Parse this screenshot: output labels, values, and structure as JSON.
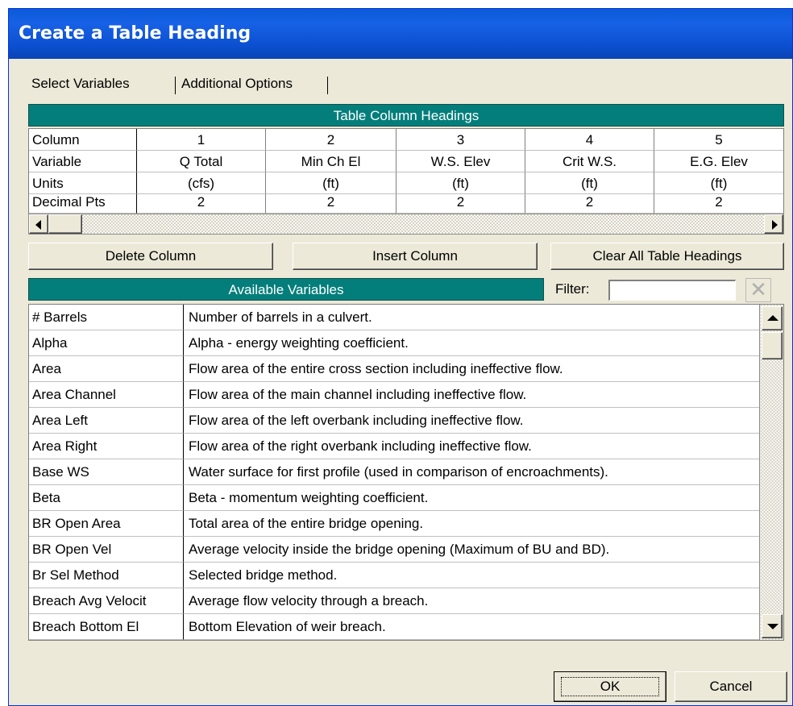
{
  "window": {
    "title": "Create a Table Heading"
  },
  "tabs": [
    {
      "label": "Select Variables"
    },
    {
      "label": "Additional Options"
    }
  ],
  "table_headings": {
    "title": "Table Column Headings",
    "row_labels": [
      "Column",
      "Variable",
      "Units",
      "Decimal Pts"
    ],
    "columns": [
      {
        "number": "1",
        "variable": "Q Total",
        "units": "(cfs)",
        "decimal": "2"
      },
      {
        "number": "2",
        "variable": "Min Ch El",
        "units": "(ft)",
        "decimal": "2"
      },
      {
        "number": "3",
        "variable": "W.S. Elev",
        "units": "(ft)",
        "decimal": "2"
      },
      {
        "number": "4",
        "variable": "Crit W.S.",
        "units": "(ft)",
        "decimal": "2"
      },
      {
        "number": "5",
        "variable": "E.G. Elev",
        "units": "(ft)",
        "decimal": "2"
      }
    ]
  },
  "buttons": {
    "delete_column": "Delete Column",
    "insert_column": "Insert Column",
    "clear_all": "Clear All Table Headings",
    "ok": "OK",
    "cancel": "Cancel"
  },
  "available": {
    "title": "Available Variables",
    "filter_label": "Filter:",
    "filter_value": "",
    "rows": [
      {
        "name": "# Barrels",
        "desc": "Number of barrels in a culvert."
      },
      {
        "name": "Alpha",
        "desc": "Alpha - energy weighting coefficient."
      },
      {
        "name": "Area",
        "desc": "Flow area of the entire cross section including ineffective flow."
      },
      {
        "name": "Area Channel",
        "desc": "Flow area of the main channel including ineffective flow."
      },
      {
        "name": "Area Left",
        "desc": "Flow area of the left overbank including ineffective flow."
      },
      {
        "name": "Area Right",
        "desc": "Flow area of the right overbank including ineffective flow."
      },
      {
        "name": "Base WS",
        "desc": "Water surface for first profile (used in comparison of encroachments)."
      },
      {
        "name": "Beta",
        "desc": "Beta - momentum weighting coefficient."
      },
      {
        "name": "BR Open Area",
        "desc": "Total area of the entire bridge opening."
      },
      {
        "name": "BR Open Vel",
        "desc": "Average velocity inside the bridge opening (Maximum of BU and BD)."
      },
      {
        "name": "Br Sel Method",
        "desc": "Selected bridge method."
      },
      {
        "name": "Breach Avg Velocit",
        "desc": "Average flow velocity through a breach."
      },
      {
        "name": "Breach Bottom El",
        "desc": "Bottom Elevation of weir breach."
      }
    ]
  }
}
